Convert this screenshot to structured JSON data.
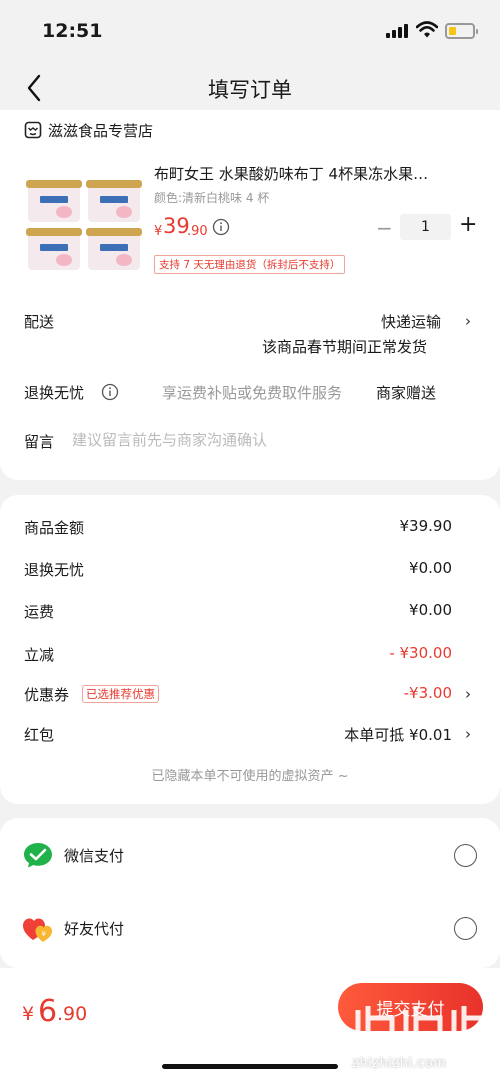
{
  "status_bar": {
    "time": "12:51"
  },
  "nav": {
    "title": "填写订单"
  },
  "store": {
    "name": "滋滋食品专营店"
  },
  "product": {
    "title": "布町女王 水果酸奶味布丁 4杯果冻水果…",
    "spec": "颜色:清新白桃味 4 杯",
    "price_symbol": "¥",
    "price_int": "39",
    "price_dec": ".90",
    "quantity": "1",
    "minus_label": "−",
    "plus_label": "+",
    "return_policy": "支持 7 天无理由退货（拆封后不支持）"
  },
  "delivery": {
    "label": "配送",
    "value": "快递运输",
    "note": "该商品春节期间正常发货"
  },
  "refund_service": {
    "label": "退换无忧",
    "description": "享运费补贴或免费取件服务",
    "value": "商家赠送"
  },
  "message": {
    "label": "留言",
    "placeholder": "建议留言前先与商家沟通确认"
  },
  "summary": {
    "rows": [
      {
        "label": "商品金额",
        "value": "¥39.90"
      },
      {
        "label": "退换无忧",
        "value": "¥0.00"
      },
      {
        "label": "运费",
        "value": "¥0.00"
      },
      {
        "label": "立减",
        "value": "- ¥30.00"
      },
      {
        "label": "优惠券",
        "value": "-¥3.00",
        "tag": "已选推荐优惠"
      },
      {
        "label": "红包",
        "value": "本单可抵 ¥0.01"
      }
    ],
    "hidden_note": "已隐藏本单不可使用的虚拟资产 ~"
  },
  "payment": {
    "options": [
      {
        "label": "微信支付",
        "icon": "wechat-pay-icon"
      },
      {
        "label": "好友代付",
        "icon": "friend-pay-icon"
      }
    ]
  },
  "footer": {
    "total_symbol": "¥",
    "total_int": "6",
    "total_dec": ".90",
    "submit_label": "提交支付"
  },
  "watermark": {
    "text": "zhizhizhi.com"
  },
  "colors": {
    "accent": "#e83a2f",
    "wechat_green": "#21b24b"
  }
}
